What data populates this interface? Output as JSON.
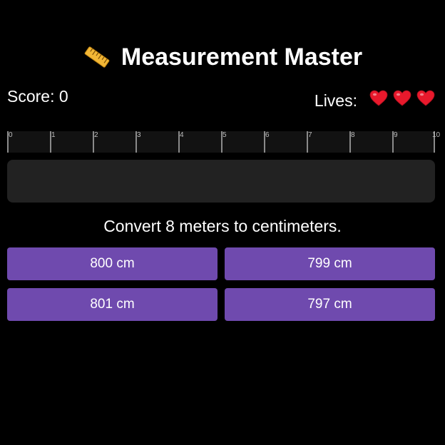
{
  "header": {
    "icon": "ruler-icon",
    "title": "Measurement Master"
  },
  "status": {
    "score_text": "Score: 0",
    "lives_label": "Lives:",
    "lives": 3,
    "life_icon": "heart-icon",
    "heart_color": "#e8192c"
  },
  "ruler": {
    "labels": [
      "0",
      "1",
      "2",
      "3",
      "4",
      "5",
      "6",
      "7",
      "8",
      "9",
      "10"
    ]
  },
  "question": {
    "text": "Convert 8 meters to centimeters."
  },
  "options": [
    {
      "label": "800 cm"
    },
    {
      "label": "799 cm"
    },
    {
      "label": "801 cm"
    },
    {
      "label": "797 cm"
    }
  ],
  "colors": {
    "background": "#000000",
    "button": "#6f4aae",
    "answer_area": "#222222",
    "ruler": "#121212"
  }
}
